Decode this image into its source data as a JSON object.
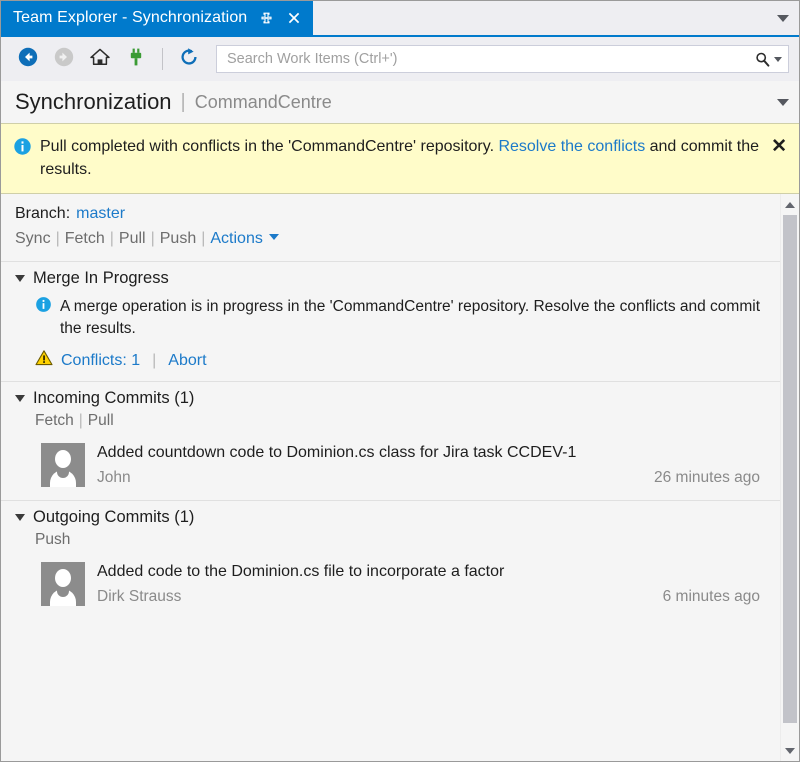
{
  "titlebar": {
    "tab_label": "Team Explorer - Synchronization",
    "pin_icon": "pin-icon",
    "close_icon": "close-icon",
    "dropdown_icon": "chevron-down-icon"
  },
  "toolbar": {
    "back_icon": "back-arrow-icon",
    "forward_icon": "forward-arrow-icon",
    "home_icon": "home-icon",
    "connect_icon": "plug-connect-icon",
    "refresh_icon": "refresh-icon",
    "search_icon": "search-icon",
    "search_placeholder": "Search Work Items (Ctrl+')",
    "search_value": ""
  },
  "page_header": {
    "title": "Synchronization",
    "separator": "|",
    "subtitle": "CommandCentre",
    "dropdown_icon": "chevron-down-icon"
  },
  "notification": {
    "icon": "info-icon",
    "text_before": "Pull completed with conflicts in the 'CommandCentre' repository. ",
    "link": "Resolve the conflicts",
    "text_after": " and commit the results.",
    "close_label": "✕",
    "bg_color": "#fffcc9",
    "link_color": "#1c7ac9"
  },
  "branch": {
    "label": "Branch:",
    "name": "master"
  },
  "commands": {
    "sync": "Sync",
    "fetch": "Fetch",
    "pull": "Pull",
    "push": "Push",
    "actions": "Actions",
    "separator": "|"
  },
  "sections": {
    "merge": {
      "title": "Merge In Progress",
      "info_icon": "info-icon",
      "message": "A merge operation is in progress in the 'CommandCentre' repository. Resolve the conflicts and commit the results.",
      "warning_icon": "warning-icon",
      "conflicts_link": "Conflicts: 1",
      "abort_link": "Abort",
      "separator": "|"
    },
    "incoming": {
      "title": "Incoming Commits (1)",
      "fetch": "Fetch",
      "pull": "Pull",
      "separator": "|",
      "commits": [
        {
          "message": "Added countdown code to Dominion.cs class for Jira task CCDEV-1",
          "author": "John",
          "time": "26 minutes ago",
          "avatar_icon": "avatar-person-icon"
        }
      ]
    },
    "outgoing": {
      "title": "Outgoing Commits (1)",
      "push": "Push",
      "commits": [
        {
          "message": "Added code to the Dominion.cs file to incorporate a factor",
          "author": "Dirk Strauss",
          "time": "6 minutes ago",
          "avatar_icon": "avatar-person-icon"
        }
      ]
    }
  },
  "scrollbar": {
    "up_icon": "scroll-up-icon",
    "down_icon": "scroll-down-icon"
  },
  "colors": {
    "accent": "#007acc",
    "link": "#1c7ac9",
    "notice_bg": "#fffcc9",
    "warning": "#ffd200",
    "info": "#1ba1e2",
    "connect_green": "#3a9b35"
  }
}
